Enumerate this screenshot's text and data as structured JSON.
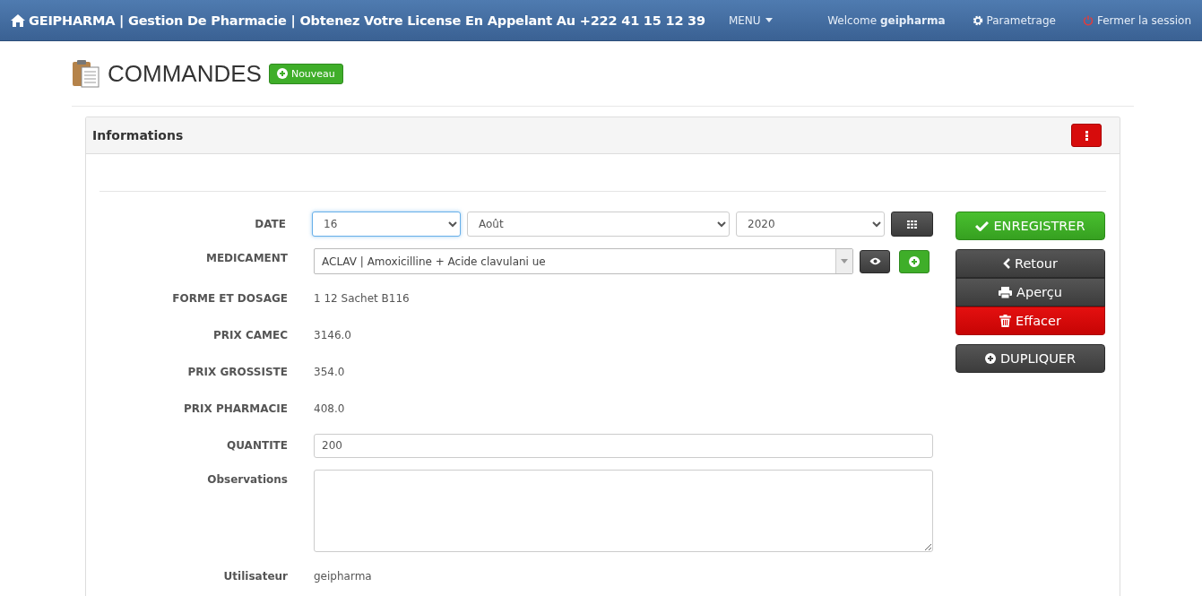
{
  "navbar": {
    "brand": "GEIPHARMA | Gestion De Pharmacie | Obtenez Votre License En Appelant Au +222 41 15 12 39",
    "menu": "MENU",
    "welcome": "Welcome",
    "user": "geipharma",
    "links": [
      {
        "kind": "settings",
        "label": "Parametrage"
      },
      {
        "kind": "logout",
        "label": "Fermer la session"
      }
    ]
  },
  "page": {
    "title": "COMMANDES",
    "new_button": "Nouveau"
  },
  "panel": {
    "title": "Informations"
  },
  "form": [
    {
      "kind": "date",
      "label": "DATE",
      "day": {
        "value": "16",
        "focused": true
      },
      "month": {
        "value": "Août",
        "focused": false
      },
      "year": {
        "value": "2020",
        "focused": false
      }
    },
    {
      "kind": "combo",
      "label": "MEDICAMENT",
      "value": "ACLAV | Amoxicilline + Acide clavulani ue"
    },
    {
      "kind": "static",
      "label": "FORME ET DOSAGE",
      "value": "1 12 Sachet B116"
    },
    {
      "kind": "static",
      "label": "PRIX CAMEC",
      "value": "3146.0"
    },
    {
      "kind": "static",
      "label": "PRIX GROSSISTE",
      "value": "354.0"
    },
    {
      "kind": "static",
      "label": "PRIX PHARMACIE",
      "value": "408.0"
    },
    {
      "kind": "input",
      "label": "QUANTITE",
      "value": "200"
    },
    {
      "kind": "textarea",
      "label": "Observations"
    },
    {
      "kind": "static",
      "label": "Utilisateur",
      "value": "geipharma"
    }
  ],
  "actions": [
    {
      "kind": "save",
      "label": "ENREGISTRER"
    },
    {
      "kind": "back",
      "label": "Retour"
    },
    {
      "kind": "print",
      "label": "Aperçu"
    },
    {
      "kind": "delete",
      "label": "Effacer"
    },
    {
      "kind": "duplicate",
      "label": "DUPLIQUER"
    }
  ]
}
